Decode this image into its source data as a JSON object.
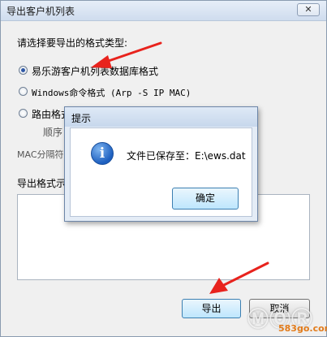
{
  "window": {
    "title": "导出客户机列表",
    "close_label": "✕"
  },
  "form": {
    "prompt": "请选择要导出的格式类型:",
    "options": [
      {
        "label": "易乐游客户机列表数据库格式",
        "checked": true
      },
      {
        "label": "Windows命令格式 (Arp -S IP MAC)",
        "checked": false
      },
      {
        "label": "路由格式",
        "checked": false
      }
    ],
    "order_label": "顺序",
    "mac_separator_label": "MAC分隔符",
    "preview_label": "导出格式示"
  },
  "buttons": {
    "export_label": "导出",
    "cancel_label": "取消"
  },
  "dialog": {
    "title": "提示",
    "message": "文件已保存至：E:\\ews.dat",
    "ok_label": "确定",
    "icon": "info-icon"
  },
  "watermark": {
    "logo": "ⓂⓄⓇ",
    "url": "583go.com"
  },
  "colors": {
    "arrow": "#e8231d",
    "accent": "#2f58a5",
    "watermark_url": "#e27b1a"
  }
}
